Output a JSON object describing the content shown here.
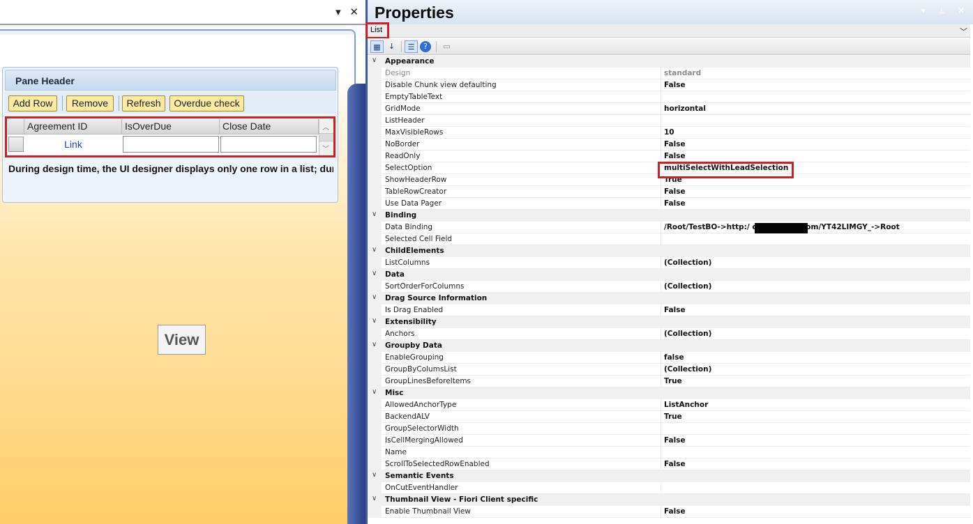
{
  "designer": {
    "pane_header": "Pane Header",
    "toolbar_buttons": [
      "Add Row",
      "Remove",
      "Refresh",
      "Overdue check"
    ],
    "list_columns": [
      "Agreement ID",
      "IsOverDue",
      "Close Date"
    ],
    "row_link": "Link",
    "note": "During design time, the UI designer displays only one row in a list; during runtime, all rows are displayed.",
    "view_label": "View",
    "window_controls": {
      "dropdown": "▾",
      "close": "✕"
    }
  },
  "properties": {
    "title": "Properties",
    "object_selector": "List",
    "title_controls": {
      "dropdown": "▾",
      "pin": "⊥",
      "close": "✕"
    },
    "groups": [
      {
        "name": "Appearance",
        "items": [
          {
            "name": "Design",
            "value": "standard",
            "readonly": true
          },
          {
            "name": "Disable Chunk view defaulting",
            "value": "False"
          },
          {
            "name": "EmptyTableText",
            "value": ""
          },
          {
            "name": "GridMode",
            "value": "horizontal"
          },
          {
            "name": "ListHeader",
            "value": ""
          },
          {
            "name": "MaxVisibleRows",
            "value": "10"
          },
          {
            "name": "NoBorder",
            "value": "False"
          },
          {
            "name": "ReadOnly",
            "value": "False"
          },
          {
            "name": "SelectOption",
            "value": "multiSelectWithLeadSelection"
          },
          {
            "name": "ShowHeaderRow",
            "value": "True"
          },
          {
            "name": "TableRowCreator",
            "value": "False"
          },
          {
            "name": "Use Data Pager",
            "value": "False"
          }
        ]
      },
      {
        "name": "Binding",
        "items": [
          {
            "name": "Data Binding",
            "value": "/Root/TestBO->http:/                    one-off.sap.com/YT42LIMGY_->Root"
          },
          {
            "name": "Selected Cell Field",
            "value": ""
          }
        ]
      },
      {
        "name": "ChildElements",
        "items": [
          {
            "name": "ListColumns",
            "value": "(Collection)"
          }
        ]
      },
      {
        "name": "Data",
        "items": [
          {
            "name": "SortOrderForColumns",
            "value": "(Collection)"
          }
        ]
      },
      {
        "name": "Drag Source Information",
        "items": [
          {
            "name": "Is Drag Enabled",
            "value": "False"
          }
        ]
      },
      {
        "name": "Extensibility",
        "items": [
          {
            "name": "Anchors",
            "value": "(Collection)"
          }
        ]
      },
      {
        "name": "Groupby Data",
        "items": [
          {
            "name": "EnableGrouping",
            "value": "false"
          },
          {
            "name": "GroupByColumsList",
            "value": "(Collection)"
          },
          {
            "name": "GroupLinesBeforeItems",
            "value": "True"
          }
        ]
      },
      {
        "name": "Misc",
        "items": [
          {
            "name": "AllowedAnchorType",
            "value": "ListAnchor"
          },
          {
            "name": "BackendALV",
            "value": "True"
          },
          {
            "name": "GroupSelectorWidth",
            "value": ""
          },
          {
            "name": "IsCellMergingAllowed",
            "value": "False"
          },
          {
            "name": "Name",
            "value": ""
          },
          {
            "name": "ScrollToSelectedRowEnabled",
            "value": "False"
          }
        ]
      },
      {
        "name": "Semantic Events",
        "items": [
          {
            "name": "OnCutEventHandler",
            "value": ""
          }
        ]
      },
      {
        "name": "Thumbnail View - Fiori Client specific",
        "items": [
          {
            "name": "Enable Thumbnail View",
            "value": "False"
          }
        ]
      }
    ]
  },
  "colors": {
    "highlight": "#d21f26",
    "button_fill": "#fbeaa0",
    "link": "#1f4aa8"
  }
}
